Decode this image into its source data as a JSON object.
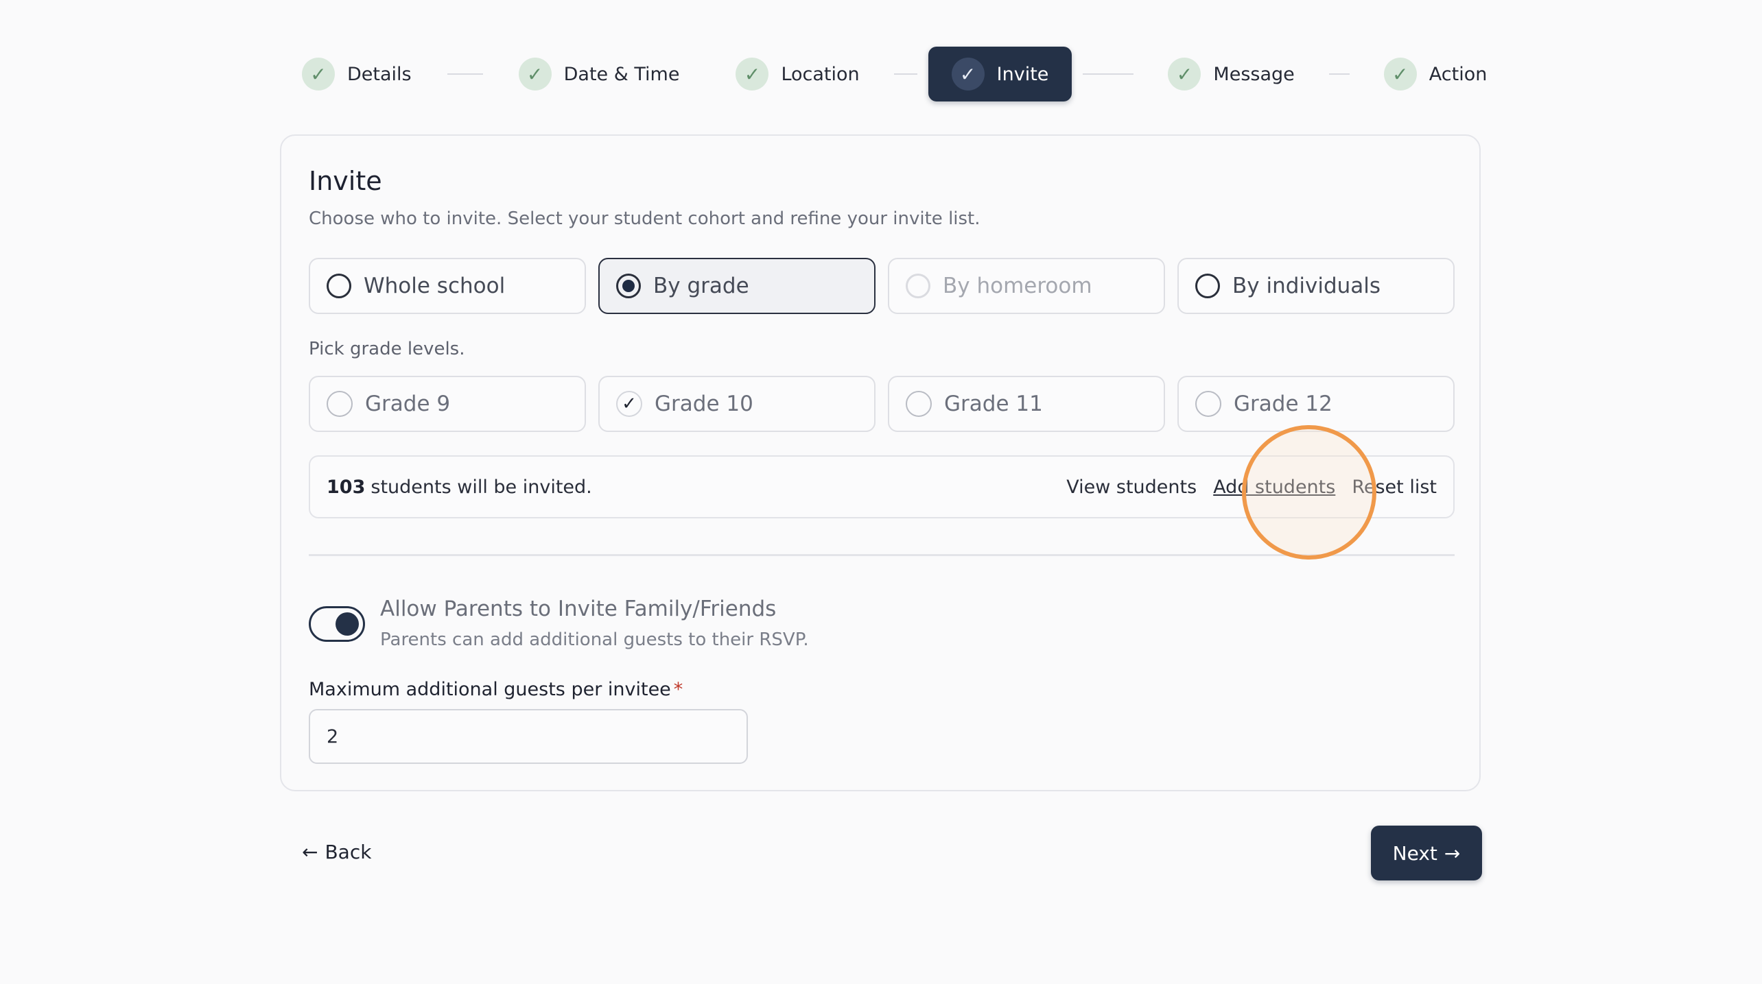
{
  "stepper": {
    "steps": [
      {
        "label": "Details",
        "state": "complete"
      },
      {
        "label": "Date & Time",
        "state": "complete"
      },
      {
        "label": "Location",
        "state": "complete"
      },
      {
        "label": "Invite",
        "state": "active"
      },
      {
        "label": "Message",
        "state": "complete"
      },
      {
        "label": "Action",
        "state": "complete"
      }
    ],
    "check_glyph": "✓"
  },
  "invite": {
    "title": "Invite",
    "subtitle": "Choose who to invite. Select your student cohort and refine your invite list.",
    "audience_options": [
      {
        "label": "Whole school",
        "selected": false,
        "disabled": false
      },
      {
        "label": "By grade",
        "selected": true,
        "disabled": false
      },
      {
        "label": "By homeroom",
        "selected": false,
        "disabled": true
      },
      {
        "label": "By individuals",
        "selected": false,
        "disabled": false
      }
    ],
    "grade_prompt": "Pick grade levels.",
    "grades": [
      {
        "label": "Grade 9",
        "checked": false
      },
      {
        "label": "Grade 10",
        "checked": true
      },
      {
        "label": "Grade 11",
        "checked": false
      },
      {
        "label": "Grade 12",
        "checked": false
      }
    ],
    "summary": {
      "count": "103",
      "text": "students will be invited.",
      "view_label": "View students",
      "add_label": "Add students",
      "reset_label": "Reset list"
    },
    "toggle": {
      "title": "Allow Parents to Invite Family/Friends",
      "description": "Parents can add additional guests to their RSVP.",
      "on": true
    },
    "max_guests": {
      "label": "Maximum additional guests per invitee",
      "required_mark": "*",
      "value": "2"
    }
  },
  "footer": {
    "back_label": "Back",
    "next_label": "Next",
    "back_icon": "←",
    "next_icon": "→"
  },
  "colors": {
    "primary": "#243147",
    "check_bg": "#d9e8dc",
    "cursor_highlight": "#f0994a"
  }
}
